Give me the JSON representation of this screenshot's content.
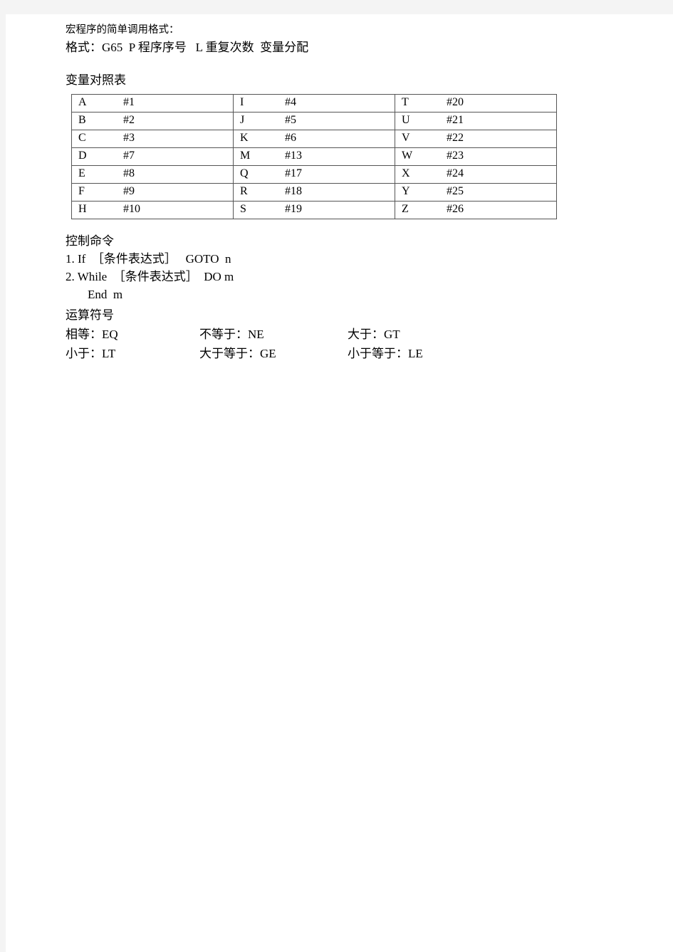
{
  "document": {
    "intro": {
      "title": "宏程序的简单调用格式：",
      "format_line": "格式：G65  P 程序序号   L 重复次数  变量分配"
    },
    "table": {
      "caption": "变量对照表",
      "rows": [
        {
          "c1k": "A",
          "c1v": "#1",
          "c2k": "I",
          "c2v": "#4",
          "c3k": "T",
          "c3v": "#20"
        },
        {
          "c1k": "B",
          "c1v": "#2",
          "c2k": "J",
          "c2v": "#5",
          "c3k": "U",
          "c3v": "#21"
        },
        {
          "c1k": "C",
          "c1v": "#3",
          "c2k": "K",
          "c2v": "#6",
          "c3k": "V",
          "c3v": "#22"
        },
        {
          "c1k": "D",
          "c1v": "#7",
          "c2k": "M",
          "c2v": "#13",
          "c3k": "W",
          "c3v": "#23"
        },
        {
          "c1k": "E",
          "c1v": "#8",
          "c2k": "Q",
          "c2v": "#17",
          "c3k": "X",
          "c3v": "#24"
        },
        {
          "c1k": "F",
          "c1v": "#9",
          "c2k": "R",
          "c2v": "#18",
          "c3k": "Y",
          "c3v": "#25"
        },
        {
          "c1k": "H",
          "c1v": "#10",
          "c2k": "S",
          "c2v": "#19",
          "c3k": "Z",
          "c3v": "#26"
        }
      ]
    },
    "control": {
      "heading": "控制命令",
      "lines": [
        "1. If  ［条件表达式］   GOTO  n",
        "2. While  ［条件表达式］  DO m",
        "End  m"
      ]
    },
    "operators": {
      "heading": "运算符号",
      "rows": [
        {
          "col1": "相等：EQ",
          "col2": "不等于：NE",
          "col3": "大于：GT"
        },
        {
          "col1": "小于：LT",
          "col2": "大于等于：GE",
          "col3": "小于等于：LE"
        }
      ]
    }
  },
  "colors": {
    "page_background": "#ffffff",
    "margin_background": "#f4f4f4",
    "text": "#000000",
    "table_border": "#555555"
  }
}
